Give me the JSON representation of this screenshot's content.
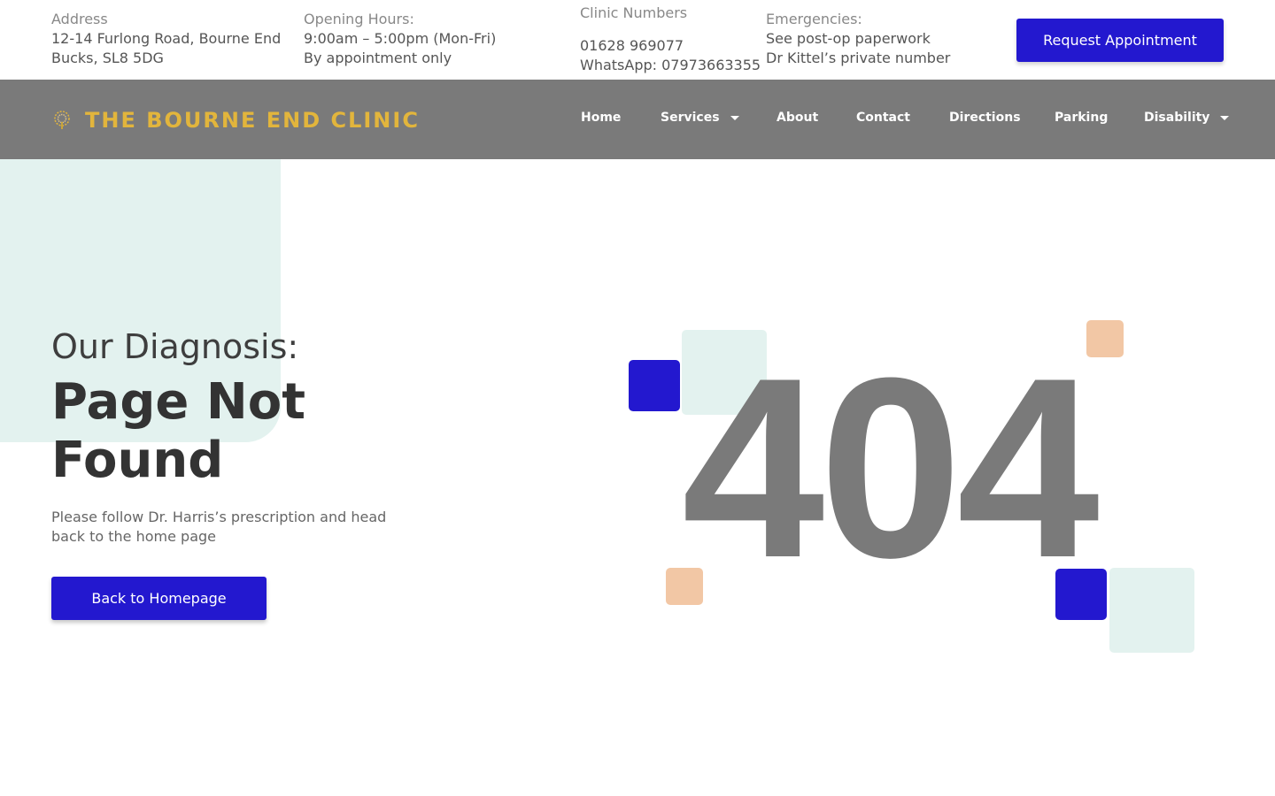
{
  "topbar": {
    "address": {
      "label": "Address",
      "line1": "12-14 Furlong Road, Bourne End",
      "line2": "Bucks, SL8 5DG"
    },
    "hours": {
      "label": "Opening Hours:",
      "line1": "9:00am – 5:00pm (Mon-Fri)",
      "line2": "By appointment only"
    },
    "numbers": {
      "label": "Clinic Numbers",
      "line1": "01628 969077",
      "line2": "WhatsApp: 07973663355"
    },
    "emergencies": {
      "label": "Emergencies:",
      "line1": "See post-op paperwork",
      "line2": "Dr Kittel’s private number"
    },
    "cta": "Request Appointment"
  },
  "header": {
    "logo_text": "THE BOURNE END CLINIC",
    "nav": [
      {
        "label": "Home"
      },
      {
        "label": "Services"
      },
      {
        "label": "About"
      },
      {
        "label": "Contact"
      },
      {
        "label": "Directions"
      },
      {
        "label": "Parking"
      },
      {
        "label": "Disability"
      }
    ]
  },
  "hero": {
    "subtitle": "Our Diagnosis:",
    "title_line1": "Page Not",
    "title_line2": "Found",
    "text": "Please follow Dr. Harris’s prescription and head back to the home page",
    "button": "Back to Homepage",
    "code": "404"
  },
  "icons": {
    "logo": "tree-icon",
    "dropdown": "caret-down-icon"
  },
  "colors": {
    "accent": "#2318cf",
    "nav_bg": "#7a7a7a",
    "logo_gold": "#e2b53c",
    "mint": "#e3f2ef",
    "peach": "#f2c7a5"
  }
}
